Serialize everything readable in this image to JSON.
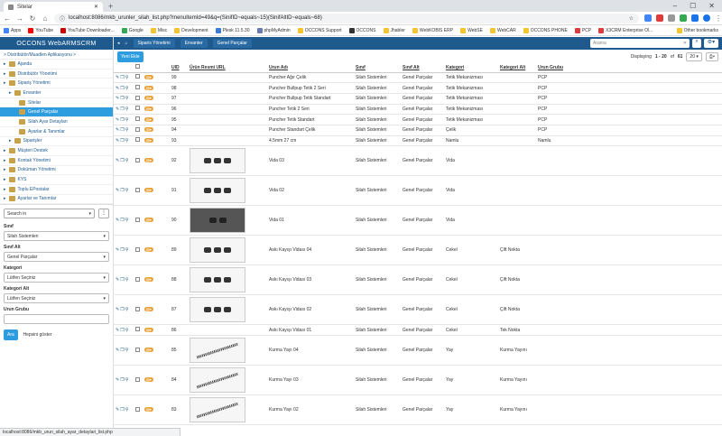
{
  "browser": {
    "tab_title": "Sitelar",
    "url": "localhost:8086/mkb_urunler_silah_list.php?menuItemId=49&q=(SinifID~equals~15)(SinifAltID~equals~68)",
    "bookmarks": [
      {
        "label": "Apps",
        "color": "#4285f4"
      },
      {
        "label": "YouTube",
        "color": "#ff0000"
      },
      {
        "label": "YouTube Downloader...",
        "color": "#cc0000"
      },
      {
        "label": "Google",
        "color": "#34a853"
      },
      {
        "label": "Misc",
        "color": "#f4c430"
      },
      {
        "label": "Development",
        "color": "#f4c430"
      },
      {
        "label": "Plesk 11.5.30",
        "color": "#3a7bd5"
      },
      {
        "label": "phpMyAdmin",
        "color": "#6c78af"
      },
      {
        "label": "OCCONS Support",
        "color": "#f4c430"
      },
      {
        "label": "OCCONS",
        "color": "#333333"
      },
      {
        "label": "Jhabler",
        "color": "#f4c430"
      },
      {
        "label": "WebKOBIS ERP",
        "color": "#f4c430"
      },
      {
        "label": "WebSE",
        "color": "#f4c430"
      },
      {
        "label": "WebCAR",
        "color": "#f4c430"
      },
      {
        "label": "OCCONS PHONE",
        "color": "#f4c430"
      },
      {
        "label": "PCP",
        "color": "#e03a3a"
      },
      {
        "label": "X3CRM Enterprise Ol...",
        "color": "#e03a3a"
      },
      {
        "label": "Other bookmarks",
        "color": "#f4c430"
      }
    ],
    "status_url": "localhost:8086/mkb_urun_silah_ayar_detaylari_list.php"
  },
  "app": {
    "brand": "OCCONS WebARMSCRM",
    "breadcrumb": "> Distribütör/Muadlen Aplikasyonu >",
    "menu": [
      {
        "label": "Ajanda",
        "level": 1,
        "active": false
      },
      {
        "label": "Distribütör Yönetimi",
        "level": 1,
        "active": false
      },
      {
        "label": "Sipariş Yönetimi",
        "level": 1,
        "active": false
      },
      {
        "label": "Envanter",
        "level": 2,
        "active": false
      },
      {
        "label": "Sitelar",
        "level": 3,
        "active": false
      },
      {
        "label": "Genel Parçalar",
        "level": 3,
        "active": true
      },
      {
        "label": "Silah Ayar Detayları",
        "level": 3,
        "active": false
      },
      {
        "label": "Ayarlar & Tanımlar",
        "level": 3,
        "active": false
      },
      {
        "label": "Siparişler",
        "level": 2,
        "active": false
      },
      {
        "label": "Müşteri Destek",
        "level": 1,
        "active": false
      },
      {
        "label": "Kontak Yönetimi",
        "level": 1,
        "active": false
      },
      {
        "label": "Doküman Yönetimi",
        "level": 1,
        "active": false
      },
      {
        "label": "KYS",
        "level": 1,
        "active": false
      },
      {
        "label": "Toplu EPostalar",
        "level": 1,
        "active": false
      },
      {
        "label": "Ayarlar ve Tanımlar",
        "level": 1,
        "active": false
      }
    ],
    "topnav": [
      "Siparis Yönetimi",
      "Envanter",
      "Genel Parçalar"
    ],
    "top_search_placeholder": "Arama"
  },
  "filters": {
    "search_placeholder": "Search in",
    "sinif_label": "Sınıf",
    "sinif_value": "Silah Sistemleri",
    "sinif_alt_label": "Sınıf Alt",
    "sinif_alt_value": "Genel Parçalar",
    "kategori_label": "Kategori",
    "kategori_value": "Lütfen Seçiniz",
    "kategori_alt_label": "Kategori Alt",
    "kategori_alt_value": "Lütfen Seçiniz",
    "urun_grubu_label": "Urun Grubu",
    "apply_label": "Ara",
    "show_all_label": "Hepsini göster"
  },
  "toolbar": {
    "new_label": "Yeni Ekle",
    "display_prefix": "Displaying",
    "display_range": "1 - 20",
    "display_of": "of",
    "display_total": "61",
    "per_page": "20"
  },
  "table": {
    "columns": [
      "UID",
      "Ürün Resmi URL",
      "Urun Adı",
      "Sınıf",
      "Sınıf Alt",
      "Kategori",
      "Kategori Alt",
      "Urun Grubu"
    ],
    "rows": [
      {
        "uid": "99",
        "name": "Puncher Ağır Çelik",
        "sinif": "Silah Sistemleri",
        "alt": "Genel Parçalar",
        "kat": "Tetik Mekanizması",
        "katalt": "",
        "grup": "PCP",
        "img": ""
      },
      {
        "uid": "98",
        "name": "Puncher Bullpup Tetik 2 Seri",
        "sinif": "Silah Sistemleri",
        "alt": "Genel Parçalar",
        "kat": "Tetik Mekanizması",
        "katalt": "",
        "grup": "PCP",
        "img": ""
      },
      {
        "uid": "97",
        "name": "Puncher Bullpup Tetik Standart",
        "sinif": "Silah Sistemleri",
        "alt": "Genel Parçalar",
        "kat": "Tetik Mekanizması",
        "katalt": "",
        "grup": "PCP",
        "img": ""
      },
      {
        "uid": "96",
        "name": "Puncher Tetik 2 Seri",
        "sinif": "Silah Sistemleri",
        "alt": "Genel Parçalar",
        "kat": "Tetik Mekanizması",
        "katalt": "",
        "grup": "PCP",
        "img": ""
      },
      {
        "uid": "95",
        "name": "Puncher Tetik Standart",
        "sinif": "Silah Sistemleri",
        "alt": "Genel Parçalar",
        "kat": "Tetik Mekanizması",
        "katalt": "",
        "grup": "PCP",
        "img": ""
      },
      {
        "uid": "94",
        "name": "Puncher Standart Çelik",
        "sinif": "Silah Sistemleri",
        "alt": "Genel Parçalar",
        "kat": "Çelik",
        "katalt": "",
        "grup": "PCP",
        "img": ""
      },
      {
        "uid": "93",
        "name": "4.5mm 27 cm",
        "sinif": "Silah Sistemleri",
        "alt": "Genel Parçalar",
        "kat": "Namlu",
        "katalt": "",
        "grup": "Namlu",
        "img": ""
      },
      {
        "uid": "92",
        "name": "Vida 03",
        "sinif": "Silah Sistemleri",
        "alt": "Genel Parçalar",
        "kat": "Vida",
        "katalt": "",
        "grup": "",
        "img": "parts"
      },
      {
        "uid": "91",
        "name": "Vida 02",
        "sinif": "Silah Sistemleri",
        "alt": "Genel Parçalar",
        "kat": "Vida",
        "katalt": "",
        "grup": "",
        "img": "parts"
      },
      {
        "uid": "90",
        "name": "Vida 01",
        "sinif": "Silah Sistemleri",
        "alt": "Genel Parçalar",
        "kat": "Vida",
        "katalt": "",
        "grup": "",
        "img": "dark"
      },
      {
        "uid": "89",
        "name": "Askı Kayışı Vidası 04",
        "sinif": "Silah Sistemleri",
        "alt": "Genel Parçalar",
        "kat": "Cekel",
        "katalt": "Çift Nokta",
        "grup": "",
        "img": "parts"
      },
      {
        "uid": "88",
        "name": "Askı Kayışı Vidası 03",
        "sinif": "Silah Sistemleri",
        "alt": "Genel Parçalar",
        "kat": "Cekel",
        "katalt": "Çift Nokta",
        "grup": "",
        "img": "parts"
      },
      {
        "uid": "87",
        "name": "Askı Kayışı Vidası 02",
        "sinif": "Silah Sistemleri",
        "alt": "Genel Parçalar",
        "kat": "Cekel",
        "katalt": "Çift Nokta",
        "grup": "",
        "img": "parts"
      },
      {
        "uid": "86",
        "name": "Askı Kayışı Vidası 01",
        "sinif": "Silah Sistemleri",
        "alt": "Genel Parçalar",
        "kat": "Cekel",
        "katalt": "Tek Nokta",
        "grup": "",
        "img": ""
      },
      {
        "uid": "85",
        "name": "Kurma Yayı 04",
        "sinif": "Silah Sistemleri",
        "alt": "Genel Parçalar",
        "kat": "Yay",
        "katalt": "Kurma Yayını",
        "grup": "",
        "img": "spring"
      },
      {
        "uid": "84",
        "name": "Kurma Yayı 03",
        "sinif": "Silah Sistemleri",
        "alt": "Genel Parçalar",
        "kat": "Yay",
        "katalt": "Kurma Yayını",
        "grup": "",
        "img": "spring"
      },
      {
        "uid": "83",
        "name": "Kurma Yayı 02",
        "sinif": "Silah Sistemleri",
        "alt": "Genel Parçalar",
        "kat": "Yay",
        "katalt": "Kurma Yayını",
        "grup": "",
        "img": "spring"
      }
    ]
  }
}
